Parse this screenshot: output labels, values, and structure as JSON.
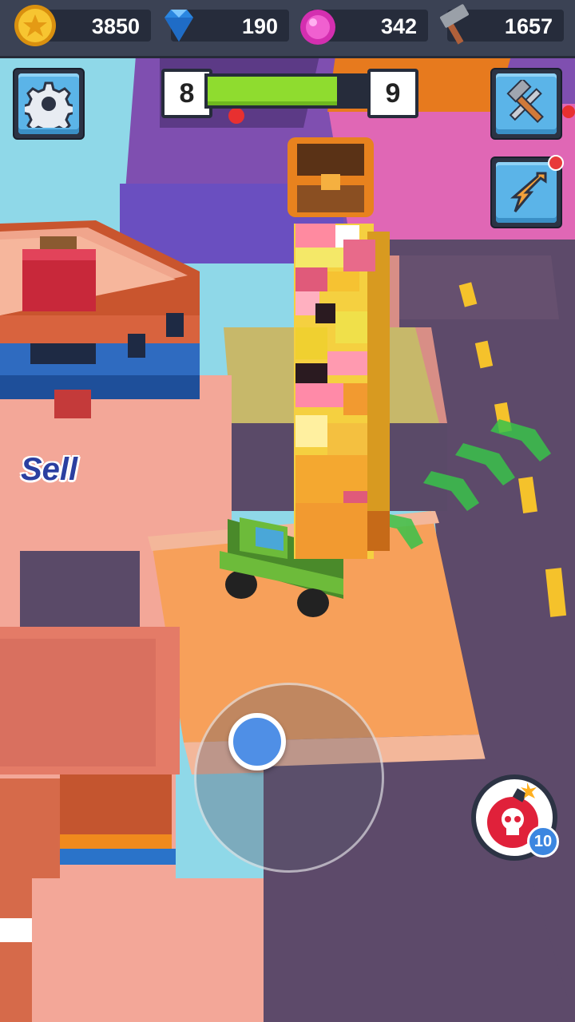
{
  "hud": {
    "resources": [
      {
        "name": "coins",
        "icon": "coin-icon",
        "value": "3850"
      },
      {
        "name": "diamonds",
        "icon": "diamond-icon",
        "value": "190"
      },
      {
        "name": "gems",
        "icon": "pink-gem-icon",
        "value": "342"
      },
      {
        "name": "hammers",
        "icon": "hammer-icon",
        "value": "1657"
      }
    ]
  },
  "level": {
    "current": "8",
    "next": "9",
    "progress": 0.82
  },
  "buttons": {
    "settings_icon": "gear-icon",
    "build_icon": "hammer-wrench-icon",
    "boost_icon": "lightning-arrow-icon"
  },
  "map": {
    "sell_label": "Sell"
  },
  "bomb": {
    "icon": "skull-bomb-icon",
    "count": "10"
  },
  "colors": {
    "hud_bg": "#3b4254",
    "button_blue": "#5bb4e8",
    "progress_green": "#8fdc2f",
    "road": "#5d4a6a",
    "sidewalk": "#f0a58c"
  }
}
